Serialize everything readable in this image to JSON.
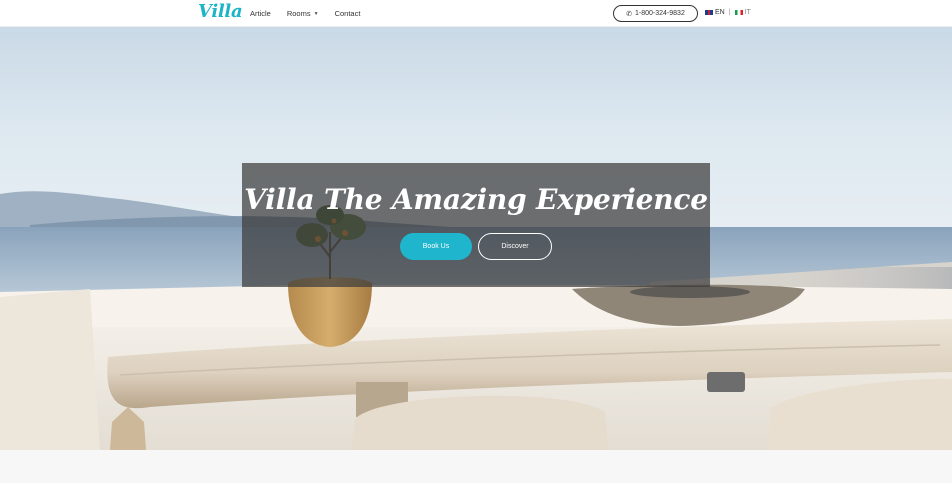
{
  "header": {
    "logo": "Villa",
    "menu": [
      {
        "label": "Article",
        "has_dropdown": false
      },
      {
        "label": "Rooms",
        "has_dropdown": true
      },
      {
        "label": "Contact",
        "has_dropdown": false
      }
    ],
    "phone_icon": "phone-icon",
    "phone": "1-800-324-9832",
    "languages": [
      {
        "code": "EN",
        "flag": "uk-flag-icon",
        "active": true
      },
      {
        "code": "IT",
        "flag": "italy-flag-icon",
        "active": false
      }
    ],
    "lang_separator": "|"
  },
  "hero": {
    "headline": "Villa The Amazing Experience",
    "primary_button": "Book Us",
    "secondary_button": "Discover",
    "image": "terrace-sea-view-photo"
  },
  "colors": {
    "accent": "#1eb4c8",
    "overlay": "rgba(60,60,60,0.72)"
  }
}
